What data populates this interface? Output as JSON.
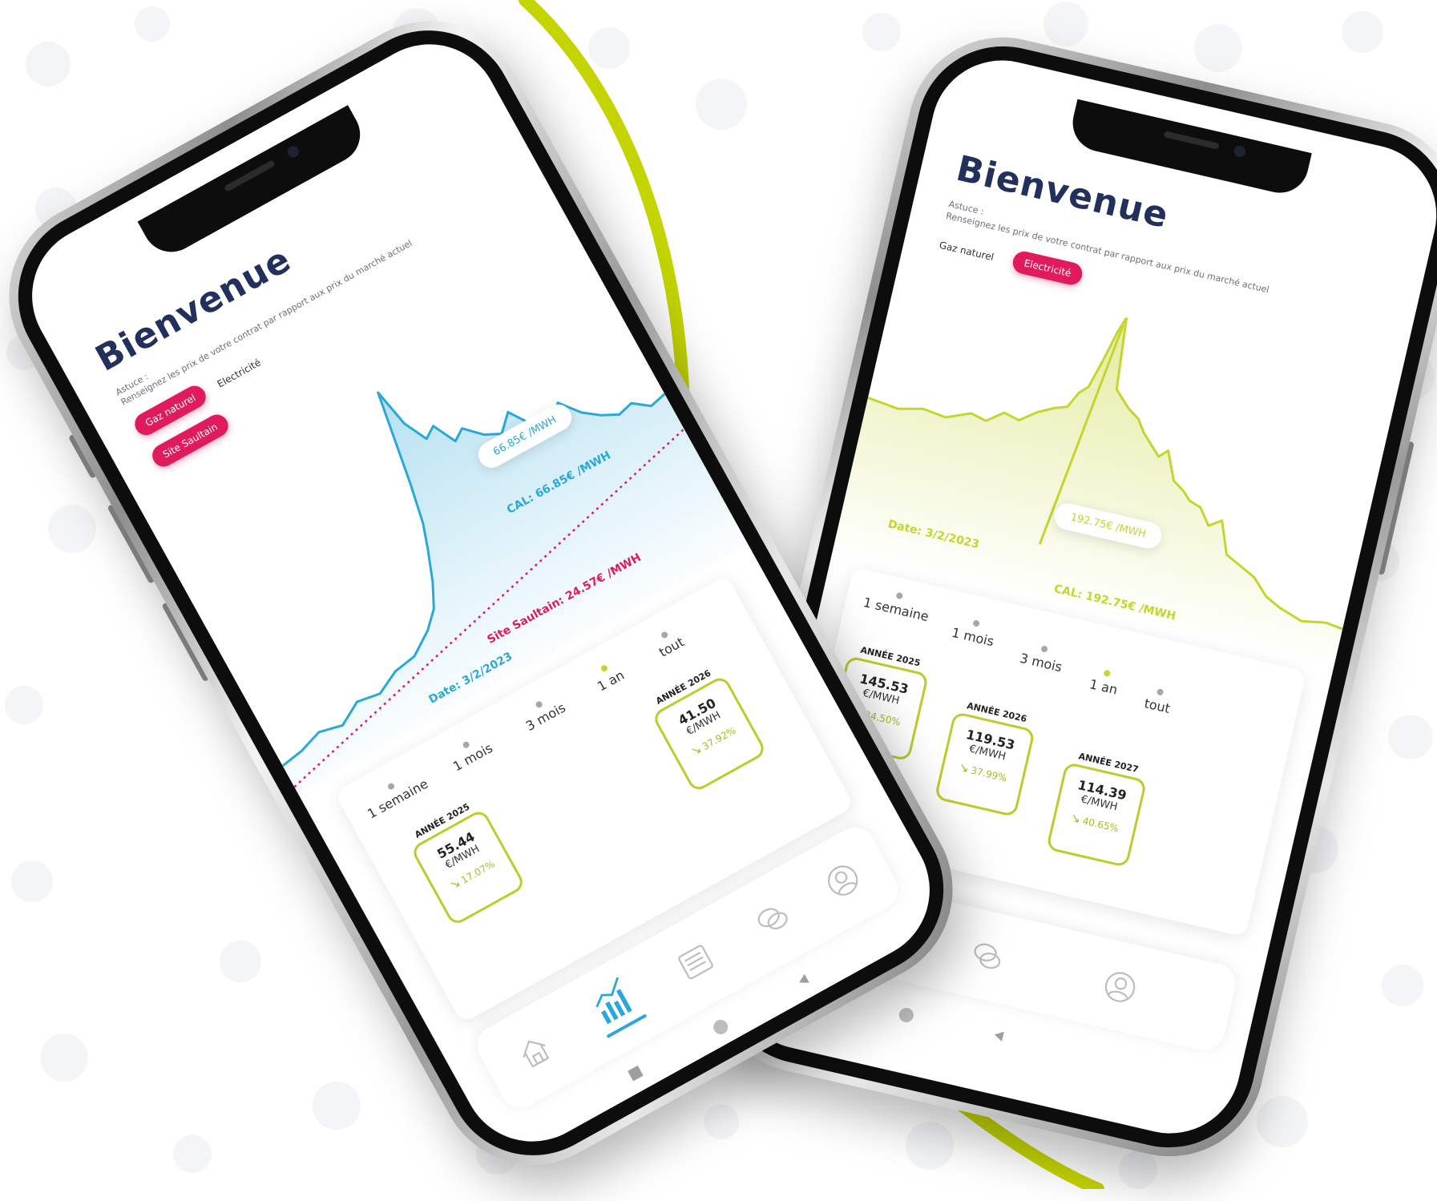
{
  "colors": {
    "accent_blue": "#2aa8d8",
    "accent_lime": "#c5d52d",
    "accent_pink": "#e01a5c",
    "title_navy": "#22305c",
    "arc_lime": "#c3d400"
  },
  "phone_left": {
    "title": "Bienvenue",
    "tip_label": "Astuce :",
    "tip_text": "Renseignez les prix de votre contrat par rapport aux prix du marché actuel",
    "tabs": [
      {
        "label": "Gaz naturel",
        "active": true
      },
      {
        "label": "Electricité",
        "active": false
      }
    ],
    "site_pill": "Site Saultain",
    "chart": {
      "price_tag": "66.85€ /MWH",
      "cal_line": "CAL: 66.85€ /MWH",
      "site_line": "Site Saultain: 24.57€ /MWH",
      "date_line": "Date: 3/2/2023"
    },
    "ranges": [
      {
        "label": "1 semaine",
        "active": false
      },
      {
        "label": "1 mois",
        "active": false
      },
      {
        "label": "3 mois",
        "active": false
      },
      {
        "label": "1 an",
        "active": true
      },
      {
        "label": "tout",
        "active": false
      }
    ],
    "years": [
      {
        "title": "ANNÉE 2025",
        "value": "55.44",
        "unit": "€/MWH",
        "change": "17.07%"
      },
      {
        "title": "ANNÉE 2026",
        "value": "41.50",
        "unit": "€/MWH",
        "change": "37.92%"
      }
    ],
    "nav": [
      "home-icon",
      "chart-icon",
      "news-icon",
      "chat-icon",
      "profile-icon"
    ]
  },
  "phone_right": {
    "title": "Bienvenue",
    "tip_label": "Astuce :",
    "tip_text": "Renseignez les prix de votre contrat par rapport aux prix du marché actuel",
    "tabs": [
      {
        "label": "Gaz naturel",
        "active": false
      },
      {
        "label": "Electricité",
        "active": true
      }
    ],
    "chart": {
      "price_tag": "192.75€ /MWH",
      "cal_line": "CAL: 192.75€ /MWH",
      "date_line": "Date: 3/2/2023"
    },
    "ranges": [
      {
        "label": "1 semaine",
        "active": false
      },
      {
        "label": "1 mois",
        "active": false
      },
      {
        "label": "3 mois",
        "active": false
      },
      {
        "label": "1 an",
        "active": true
      },
      {
        "label": "tout",
        "active": false
      }
    ],
    "years": [
      {
        "title": "ANNÉE 2025",
        "value": "145.53",
        "unit": "€/MWH",
        "change": "24.50%"
      },
      {
        "title": "ANNÉE 2026",
        "value": "119.53",
        "unit": "€/MWH",
        "change": "37.99%"
      },
      {
        "title": "ANNÉE 2027",
        "value": "114.39",
        "unit": "€/MWH",
        "change": "40.65%"
      }
    ],
    "nav": [
      "news-icon",
      "chat-icon",
      "profile-icon"
    ]
  }
}
